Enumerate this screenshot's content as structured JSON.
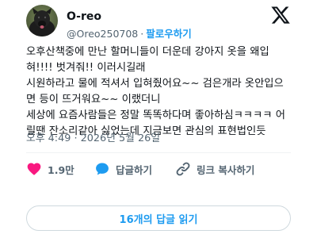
{
  "header": {
    "display_name": "O-reo",
    "handle": "@Oreo250708",
    "separator": "·",
    "follow_label": "팔로우하기"
  },
  "tweet": {
    "lines": [
      "오후산책중에 만난 할머니들이 더운데 강아지 옷을 왜입",
      "혀!!!! 벗겨줘!! 이러시길래",
      "시원하라고 물에 적셔서 입혀줬어요~~ 검은개라 옷안입으",
      "면 등이 뜨거워요~~ 이랬더니",
      "세상에 요즘사람들은 정말 똑똑하다며 좋아하심ㅋㅋㅋㅋ 어",
      "릴땐 잔소리같아 싫었는데 지금보면 관심의 표현법인듯"
    ],
    "time": "오후 4:49",
    "date_separator": "·",
    "date": "2026년 5월 26일"
  },
  "actions": {
    "like_count": "1.9만",
    "reply_label": "답글하기",
    "copy_link_label": "링크 복사하기"
  },
  "replies_button": {
    "label": "16개의 답글 읽기"
  },
  "colors": {
    "like_red": "#f91880",
    "reply_blue": "#1d9bf0",
    "link_gray": "#536471",
    "follow_blue": "#1d9bf0"
  },
  "icons": {
    "avatar": "black-dog-photo",
    "logo": "x-logo-icon",
    "like": "heart-icon",
    "reply": "speech-bubble-icon",
    "copy": "link-icon"
  }
}
